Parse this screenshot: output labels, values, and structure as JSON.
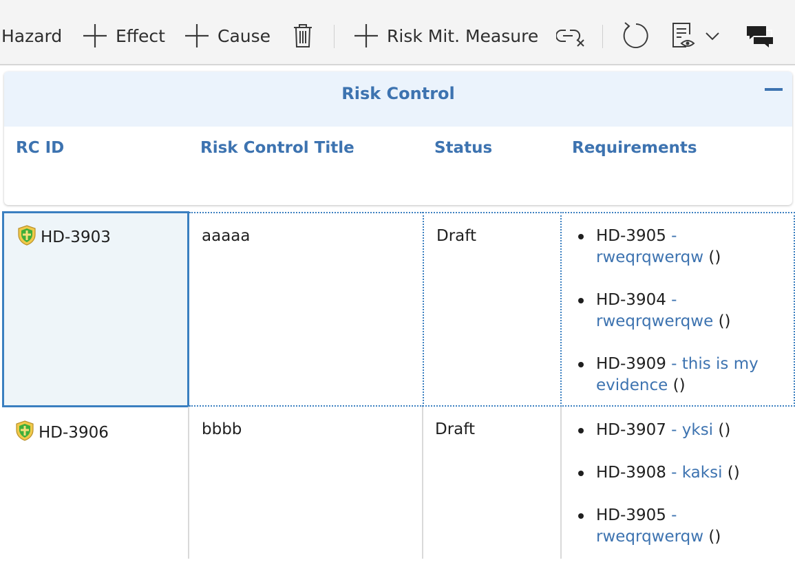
{
  "toolbar": {
    "hazard_label": "Hazard",
    "effect_label": "Effect",
    "cause_label": "Cause",
    "risk_mit_label": "Risk Mit. Measure"
  },
  "group": {
    "title": "Risk Control"
  },
  "columns": {
    "rc_id": "RC ID",
    "title": "Risk Control Title",
    "status": "Status",
    "requirements": "Requirements"
  },
  "rows": [
    {
      "id": "HD-3903",
      "title": "aaaaa",
      "status": "Draft",
      "requirements": [
        {
          "id": "HD-3905",
          "line1": "-",
          "line2": "rweqrqwerqw",
          "paren": "()"
        },
        {
          "id": "HD-3904",
          "line1": "-",
          "line2": "rweqrqwerqwe",
          "paren": "()"
        },
        {
          "id": "HD-3909",
          "line1": "- this is my",
          "line2": "evidence",
          "paren": "()"
        }
      ]
    },
    {
      "id": "HD-3906",
      "title": "bbbb",
      "status": "Draft",
      "requirements": [
        {
          "id": "HD-3907",
          "line1": "- yksi",
          "paren": "()"
        },
        {
          "id": "HD-3908",
          "line1": "- kaksi",
          "paren": "()"
        },
        {
          "id": "HD-3905",
          "line1": "-",
          "line2": "rweqrqwerqw",
          "paren": "()"
        }
      ]
    }
  ],
  "colors": {
    "accent": "#3d73b0",
    "header_bg": "#ebf3fc",
    "selected_cell_bg": "#eef5f9",
    "selected_cell_border": "#3a7fc0"
  },
  "icons": [
    "plus-icon",
    "trash-icon",
    "unlink-icon",
    "refresh-icon",
    "report-icon",
    "chevron-down-icon",
    "comments-icon",
    "shield-icon",
    "collapse-icon"
  ]
}
